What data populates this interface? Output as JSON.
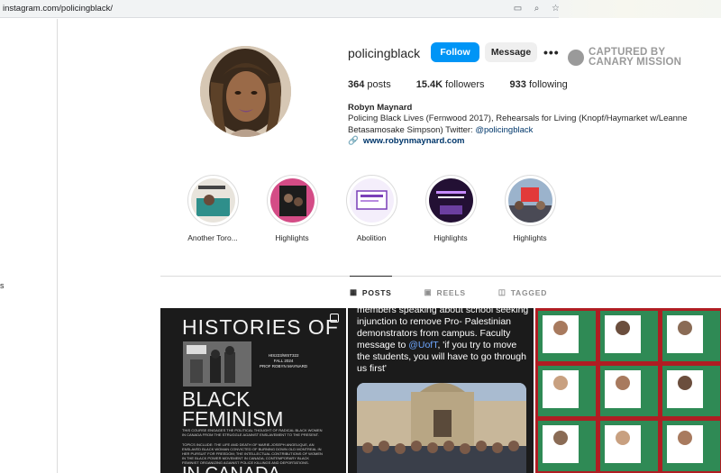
{
  "browser": {
    "url": "instagram.com/policingblack/",
    "icons": [
      "cast-icon",
      "zoom-icon",
      "star-icon"
    ]
  },
  "nav": {
    "stub_text": "s"
  },
  "profile": {
    "username": "policingblack",
    "follow_label": "Follow",
    "message_label": "Message",
    "more_label": "•••",
    "watermark_line1": "CAPTURED BY",
    "watermark_line2": "CANARY MISSION",
    "stats": {
      "posts_count": "364",
      "posts_label": "posts",
      "followers_count": "15.4K",
      "followers_label": "followers",
      "following_count": "933",
      "following_label": "following"
    },
    "bio": {
      "name": "Robyn Maynard",
      "text": "Policing Black Lives (Fernwood 2017), Rehearsals for Living (Knopf/Haymarket w/Leanne Betasamosake Simpson) Twitter: ",
      "handle": "@policingblack",
      "link": "www.robynmaynard.com"
    }
  },
  "highlights": [
    {
      "label": "Another Toro..."
    },
    {
      "label": "Highlights"
    },
    {
      "label": "Abolition"
    },
    {
      "label": "Highlights"
    },
    {
      "label": "Highlights"
    }
  ],
  "tabs": [
    {
      "label": "POSTS",
      "icon": "grid-icon"
    },
    {
      "label": "REELS",
      "icon": "reels-icon"
    },
    {
      "label": "TAGGED",
      "icon": "tag-icon"
    }
  ],
  "posts": {
    "post1": {
      "title_line1": "HISTORIES OF",
      "course": "HIS223/WST322\nFALL 2024\nPROF ROBYN MAYNARD",
      "title_line2": "BLACK",
      "title_line3": "FEMINISM",
      "small_text": "THIS COURSE ENGAGES THE POLITICAL THOUGHT OF RADICAL BLACK WOMEN IN CANADA FROM THE STRUGGLE AGAINST ENSLAVEMENT TO THE PRESENT.\n\nTOPICS INCLUDE: THE LIFE AND DEATH OF MARIE-JOSEPH ANGELIQUE, AN ENSLAVED BLACK WOMAN CONVICTED OF BURNING DOWN OLD MONTREAL IN HER PURSUIT FOR FREEDOM; THE INTELLECTUAL CONTRIBUTIONS OF WOMEN IN THE BLACK POWER MOVEMENT IN CANADA; CONTEMPORARY BLACK FEMINIST ORGANIZING AGAINST POLICE KILLINGS AND DEPORTATIONS.",
      "title_line4": "IN CANADA"
    },
    "post2": {
      "text_before": "members speaking about school seeking injunction to remove Pro- Palestinian demonstrators from campus. Faculty message to ",
      "mention": "@UofT",
      "text_after": ", 'if you try to move the students, you will have to go through us first'"
    }
  }
}
